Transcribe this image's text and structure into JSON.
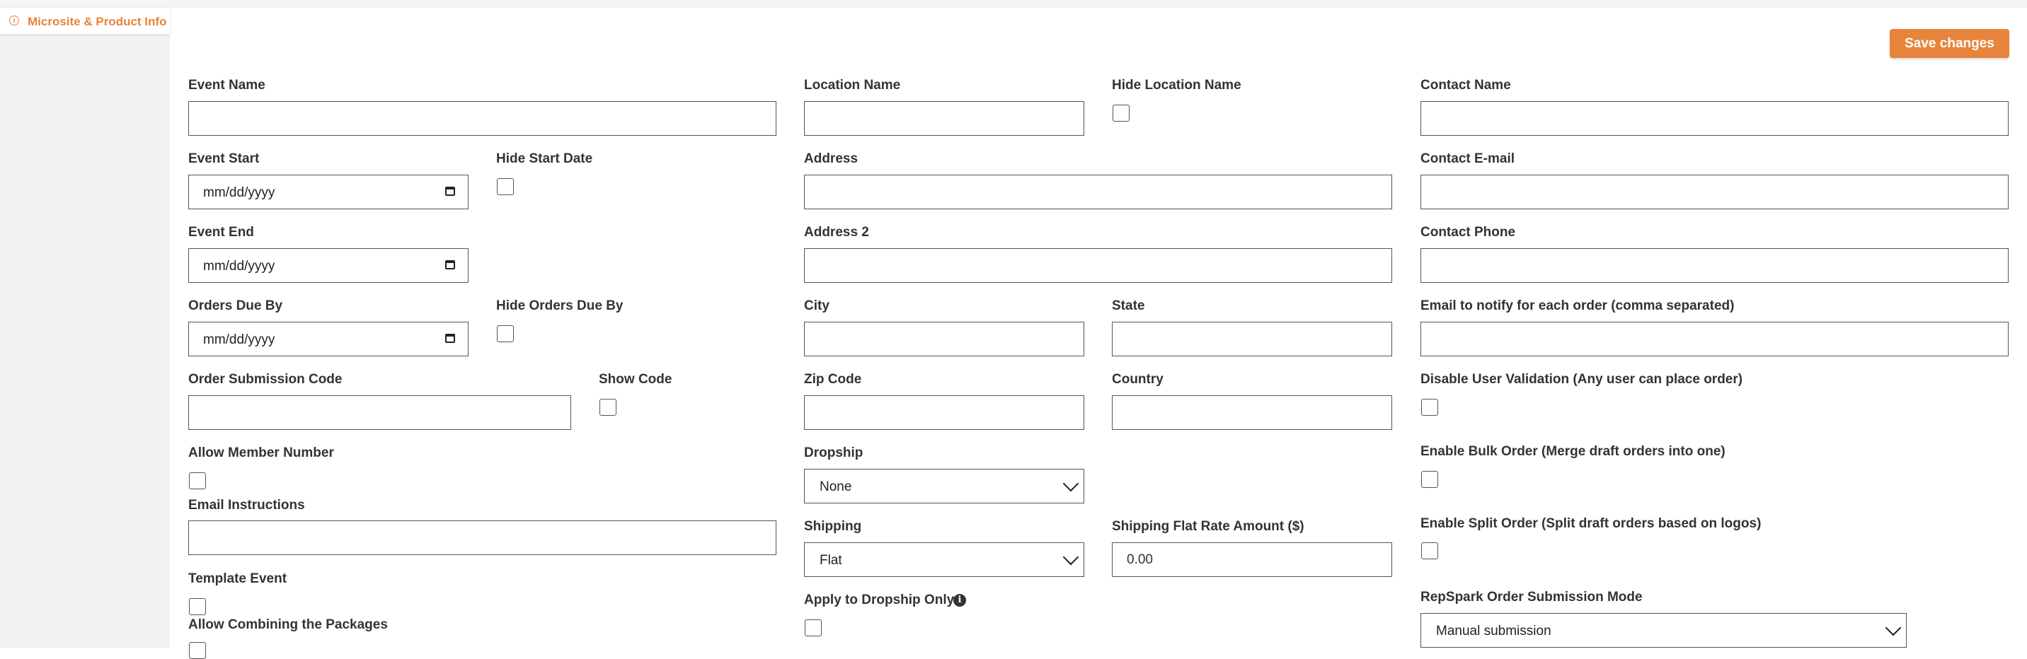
{
  "sidebar": {
    "tab_label": "Microsite & Product Info",
    "tab_icon": "info-circle-icon"
  },
  "toolbar": {
    "save_label": "Save changes"
  },
  "colors": {
    "accent": "#e8843c",
    "background_sidebar": "#f2f2f2"
  },
  "form": {
    "event_name": {
      "label": "Event Name",
      "value": ""
    },
    "event_start": {
      "label": "Event Start",
      "value": "mm/dd/yyyy"
    },
    "hide_start_date": {
      "label": "Hide Start Date",
      "checked": false
    },
    "event_end": {
      "label": "Event End",
      "value": "mm/dd/yyyy"
    },
    "orders_due_by": {
      "label": "Orders Due By",
      "value": "mm/dd/yyyy"
    },
    "hide_orders_due_by": {
      "label": "Hide Orders Due By",
      "checked": false
    },
    "order_submission_code": {
      "label": "Order Submission Code",
      "value": ""
    },
    "show_code": {
      "label": "Show Code",
      "checked": false
    },
    "allow_member_number": {
      "label": "Allow Member Number",
      "checked": false
    },
    "email_instructions": {
      "label": "Email Instructions",
      "value": ""
    },
    "template_event": {
      "label": "Template Event",
      "checked": false
    },
    "allow_combining_packages": {
      "label": "Allow Combining the Packages",
      "checked": false
    },
    "location_name": {
      "label": "Location Name",
      "value": ""
    },
    "hide_location_name": {
      "label": "Hide Location Name",
      "checked": false
    },
    "address": {
      "label": "Address",
      "value": ""
    },
    "address2": {
      "label": "Address 2",
      "value": ""
    },
    "city": {
      "label": "City",
      "value": ""
    },
    "state": {
      "label": "State",
      "value": ""
    },
    "zip_code": {
      "label": "Zip Code",
      "value": ""
    },
    "country": {
      "label": "Country",
      "value": ""
    },
    "dropship": {
      "label": "Dropship",
      "value": "None"
    },
    "shipping": {
      "label": "Shipping",
      "value": "Flat"
    },
    "shipping_flat_rate": {
      "label": "Shipping Flat Rate Amount ($)",
      "value": "0.00"
    },
    "apply_to_dropship_only": {
      "label": "Apply to Dropship Only",
      "checked": false
    },
    "contact_name": {
      "label": "Contact Name",
      "value": ""
    },
    "contact_email": {
      "label": "Contact E-mail",
      "value": ""
    },
    "contact_phone": {
      "label": "Contact Phone",
      "value": ""
    },
    "notify_email": {
      "label": "Email to notify for each order (comma separated)",
      "value": ""
    },
    "disable_user_validation": {
      "label": "Disable User Validation (Any user can place order)",
      "checked": false
    },
    "enable_bulk_order": {
      "label": "Enable Bulk Order (Merge draft orders into one)",
      "checked": false
    },
    "enable_split_order": {
      "label": "Enable Split Order (Split draft orders based on logos)",
      "checked": false
    },
    "repspark_mode": {
      "label": "RepSpark Order Submission Mode",
      "value": "Manual submission"
    }
  }
}
